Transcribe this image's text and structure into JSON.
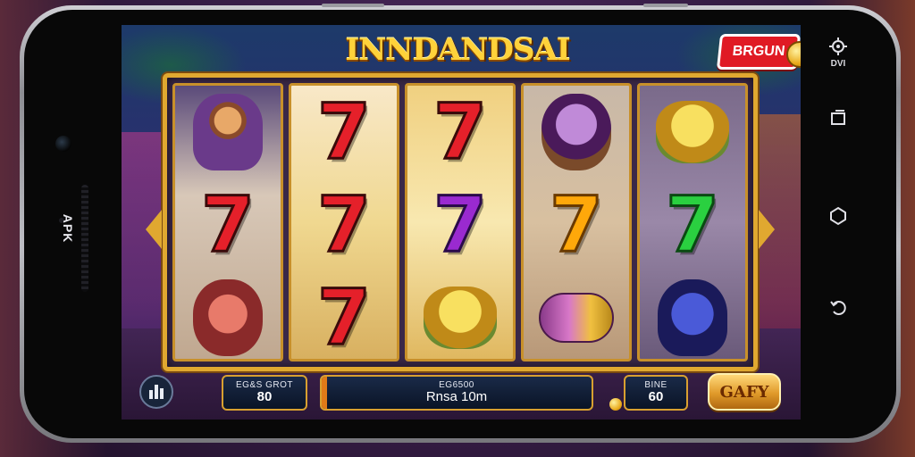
{
  "game": {
    "title": "INNDANDSAI",
    "promo_badge": "BRGUN"
  },
  "device": {
    "side_label": "APK",
    "status_label": "DVI"
  },
  "reels": [
    [
      {
        "type": "warrior",
        "name": "warrior-symbol"
      },
      {
        "type": "seven",
        "color": "red",
        "glyph": "7"
      },
      {
        "type": "demon",
        "name": "demon-symbol"
      }
    ],
    [
      {
        "type": "seven",
        "color": "red",
        "glyph": "7"
      },
      {
        "type": "seven",
        "color": "red",
        "glyph": "7"
      },
      {
        "type": "seven",
        "color": "red",
        "glyph": "7"
      }
    ],
    [
      {
        "type": "seven",
        "color": "red",
        "glyph": "7"
      },
      {
        "type": "seven",
        "color": "purple",
        "glyph": "7"
      },
      {
        "type": "goldbeast",
        "name": "golden-beast-symbol"
      }
    ],
    [
      {
        "type": "mask",
        "name": "mask-symbol"
      },
      {
        "type": "seven",
        "color": "orange",
        "glyph": "7"
      },
      {
        "type": "wrap",
        "name": "scroll-symbol"
      }
    ],
    [
      {
        "type": "goldbeast",
        "name": "golden-beast-symbol"
      },
      {
        "type": "seven",
        "color": "green",
        "glyph": "7"
      },
      {
        "type": "dragon",
        "name": "dragon-symbol"
      }
    ]
  ],
  "hud": {
    "bet": {
      "label": "EG&S GROT",
      "value": "80"
    },
    "win": {
      "label": "EG6500",
      "value": "Rnsa 10m"
    },
    "line": {
      "label": "BINE",
      "value": "60"
    },
    "spin_label": "GAFY"
  },
  "colors": {
    "accent_gold": "#e0a830",
    "badge_red": "#e01a24",
    "spin_orange": "#e09a2a"
  },
  "icons": [
    "menu-icon",
    "settings-gear-icon",
    "recent-apps-icon",
    "home-icon",
    "back-icon",
    "coin-icon"
  ]
}
